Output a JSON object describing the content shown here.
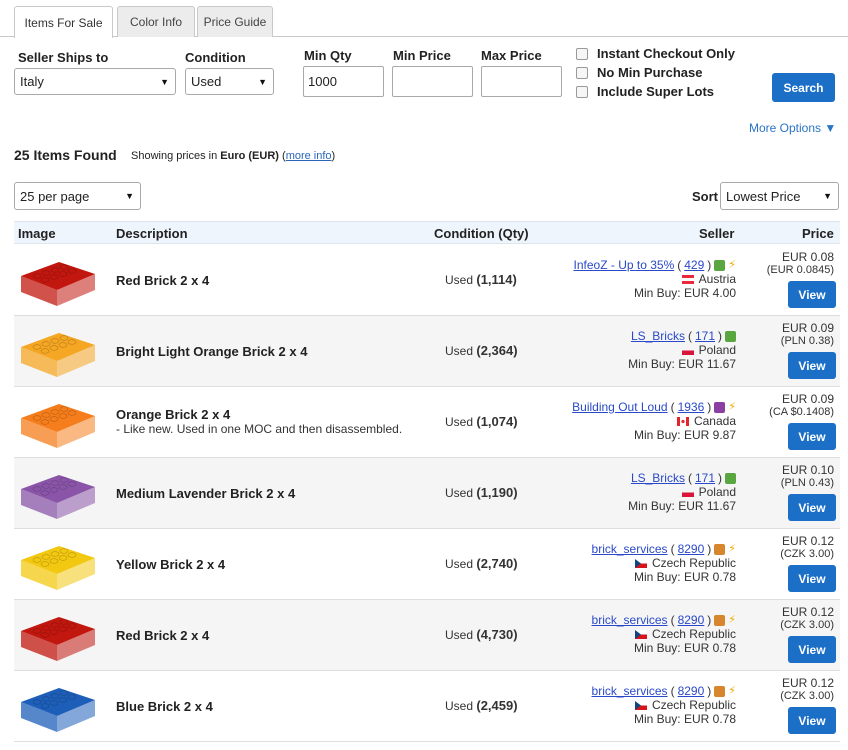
{
  "tabs": [
    "Items For Sale",
    "Color Info",
    "Price Guide"
  ],
  "filters": {
    "ships_to_label": "Seller Ships to",
    "ships_to_value": "Italy",
    "condition_label": "Condition",
    "condition_value": "Used",
    "min_qty_label": "Min Qty",
    "min_qty_value": "1000",
    "min_price_label": "Min Price",
    "min_price_value": "",
    "max_price_label": "Max Price",
    "max_price_value": "",
    "checkboxes": [
      "Instant Checkout Only",
      "No Min Purchase",
      "Include Super Lots"
    ],
    "search_label": "Search",
    "more_options": "More Options ▼"
  },
  "results": {
    "found": "25 Items Found",
    "showing_prefix": "Showing prices in ",
    "currency": "Euro (EUR)",
    "more_info": "more info",
    "per_page": "25 per page",
    "sort_label": "Sort",
    "sort_value": "Lowest Price"
  },
  "columns": [
    "Image",
    "Description",
    "Condition (Qty)",
    "Seller",
    "Price"
  ],
  "colors": {
    "accent": "#1b6fc7",
    "link": "#2a49c8",
    "header_bg": "#eef5fc"
  },
  "items": [
    {
      "color": "#c1170f",
      "desc": "Red Brick 2 x 4",
      "note": "",
      "cond": "Used",
      "qty": "(1,114)",
      "seller": "InfeoZ - Up to 35%",
      "feedback": "429",
      "cube": "#59a640",
      "bolt": true,
      "country": "Austria",
      "flag": "austria",
      "minbuy": "Min Buy: EUR 4.00",
      "price": "EUR 0.08",
      "alt_price": "(EUR 0.0845)"
    },
    {
      "color": "#f5a623",
      "desc": "Bright Light Orange Brick 2 x 4",
      "note": "",
      "cond": "Used",
      "qty": "(2,364)",
      "seller": "LS_Bricks",
      "feedback": "171",
      "cube": "#59a640",
      "bolt": false,
      "country": "Poland",
      "flag": "poland",
      "minbuy": "Min Buy: EUR 11.67",
      "price": "EUR 0.09",
      "alt_price": "(PLN 0.38)"
    },
    {
      "color": "#f57d1b",
      "desc": "Orange Brick 2 x 4",
      "note": "- Like new. Used in one MOC and then disassembled.",
      "cond": "Used",
      "qty": "(1,074)",
      "seller": "Building Out Loud",
      "feedback": "1936",
      "cube": "#8c3fa3",
      "bolt": true,
      "country": "Canada",
      "flag": "canada",
      "minbuy": "Min Buy: EUR 9.87",
      "price": "EUR 0.09",
      "alt_price": "(CA $0.1408)"
    },
    {
      "color": "#8a55a8",
      "desc": "Medium Lavender Brick 2 x 4",
      "note": "",
      "cond": "Used",
      "qty": "(1,190)",
      "seller": "LS_Bricks",
      "feedback": "171",
      "cube": "#59a640",
      "bolt": false,
      "country": "Poland",
      "flag": "poland",
      "minbuy": "Min Buy: EUR 11.67",
      "price": "EUR 0.10",
      "alt_price": "(PLN 0.43)"
    },
    {
      "color": "#f2c811",
      "desc": "Yellow Brick 2 x 4",
      "note": "",
      "cond": "Used",
      "qty": "(2,740)",
      "seller": "brick_services",
      "feedback": "8290",
      "cube": "#d8862e",
      "bolt": true,
      "country": "Czech Republic",
      "flag": "czech",
      "minbuy": "Min Buy: EUR 0.78",
      "price": "EUR 0.12",
      "alt_price": "(CZK 3.00)"
    },
    {
      "color": "#c1170f",
      "desc": "Red Brick 2 x 4",
      "note": "",
      "cond": "Used",
      "qty": "(4,730)",
      "seller": "brick_services",
      "feedback": "8290",
      "cube": "#d8862e",
      "bolt": true,
      "country": "Czech Republic",
      "flag": "czech",
      "minbuy": "Min Buy: EUR 0.78",
      "price": "EUR 0.12",
      "alt_price": "(CZK 3.00)"
    },
    {
      "color": "#1d5fb8",
      "desc": "Blue Brick 2 x 4",
      "note": "",
      "cond": "Used",
      "qty": "(2,459)",
      "seller": "brick_services",
      "feedback": "8290",
      "cube": "#d8862e",
      "bolt": true,
      "country": "Czech Republic",
      "flag": "czech",
      "minbuy": "Min Buy: EUR 0.78",
      "price": "EUR 0.12",
      "alt_price": "(CZK 3.00)"
    }
  ]
}
